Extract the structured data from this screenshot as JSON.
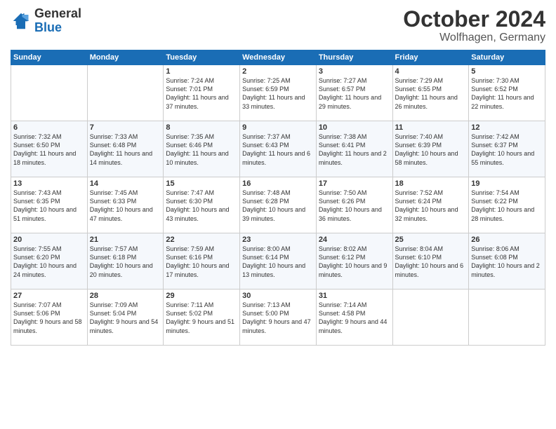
{
  "header": {
    "logo_general": "General",
    "logo_blue": "Blue",
    "month": "October 2024",
    "location": "Wolfhagen, Germany"
  },
  "weekdays": [
    "Sunday",
    "Monday",
    "Tuesday",
    "Wednesday",
    "Thursday",
    "Friday",
    "Saturday"
  ],
  "weeks": [
    [
      {
        "day": "",
        "sunrise": "",
        "sunset": "",
        "daylight": ""
      },
      {
        "day": "",
        "sunrise": "",
        "sunset": "",
        "daylight": ""
      },
      {
        "day": "1",
        "sunrise": "Sunrise: 7:24 AM",
        "sunset": "Sunset: 7:01 PM",
        "daylight": "Daylight: 11 hours and 37 minutes."
      },
      {
        "day": "2",
        "sunrise": "Sunrise: 7:25 AM",
        "sunset": "Sunset: 6:59 PM",
        "daylight": "Daylight: 11 hours and 33 minutes."
      },
      {
        "day": "3",
        "sunrise": "Sunrise: 7:27 AM",
        "sunset": "Sunset: 6:57 PM",
        "daylight": "Daylight: 11 hours and 29 minutes."
      },
      {
        "day": "4",
        "sunrise": "Sunrise: 7:29 AM",
        "sunset": "Sunset: 6:55 PM",
        "daylight": "Daylight: 11 hours and 26 minutes."
      },
      {
        "day": "5",
        "sunrise": "Sunrise: 7:30 AM",
        "sunset": "Sunset: 6:52 PM",
        "daylight": "Daylight: 11 hours and 22 minutes."
      }
    ],
    [
      {
        "day": "6",
        "sunrise": "Sunrise: 7:32 AM",
        "sunset": "Sunset: 6:50 PM",
        "daylight": "Daylight: 11 hours and 18 minutes."
      },
      {
        "day": "7",
        "sunrise": "Sunrise: 7:33 AM",
        "sunset": "Sunset: 6:48 PM",
        "daylight": "Daylight: 11 hours and 14 minutes."
      },
      {
        "day": "8",
        "sunrise": "Sunrise: 7:35 AM",
        "sunset": "Sunset: 6:46 PM",
        "daylight": "Daylight: 11 hours and 10 minutes."
      },
      {
        "day": "9",
        "sunrise": "Sunrise: 7:37 AM",
        "sunset": "Sunset: 6:43 PM",
        "daylight": "Daylight: 11 hours and 6 minutes."
      },
      {
        "day": "10",
        "sunrise": "Sunrise: 7:38 AM",
        "sunset": "Sunset: 6:41 PM",
        "daylight": "Daylight: 11 hours and 2 minutes."
      },
      {
        "day": "11",
        "sunrise": "Sunrise: 7:40 AM",
        "sunset": "Sunset: 6:39 PM",
        "daylight": "Daylight: 10 hours and 58 minutes."
      },
      {
        "day": "12",
        "sunrise": "Sunrise: 7:42 AM",
        "sunset": "Sunset: 6:37 PM",
        "daylight": "Daylight: 10 hours and 55 minutes."
      }
    ],
    [
      {
        "day": "13",
        "sunrise": "Sunrise: 7:43 AM",
        "sunset": "Sunset: 6:35 PM",
        "daylight": "Daylight: 10 hours and 51 minutes."
      },
      {
        "day": "14",
        "sunrise": "Sunrise: 7:45 AM",
        "sunset": "Sunset: 6:33 PM",
        "daylight": "Daylight: 10 hours and 47 minutes."
      },
      {
        "day": "15",
        "sunrise": "Sunrise: 7:47 AM",
        "sunset": "Sunset: 6:30 PM",
        "daylight": "Daylight: 10 hours and 43 minutes."
      },
      {
        "day": "16",
        "sunrise": "Sunrise: 7:48 AM",
        "sunset": "Sunset: 6:28 PM",
        "daylight": "Daylight: 10 hours and 39 minutes."
      },
      {
        "day": "17",
        "sunrise": "Sunrise: 7:50 AM",
        "sunset": "Sunset: 6:26 PM",
        "daylight": "Daylight: 10 hours and 36 minutes."
      },
      {
        "day": "18",
        "sunrise": "Sunrise: 7:52 AM",
        "sunset": "Sunset: 6:24 PM",
        "daylight": "Daylight: 10 hours and 32 minutes."
      },
      {
        "day": "19",
        "sunrise": "Sunrise: 7:54 AM",
        "sunset": "Sunset: 6:22 PM",
        "daylight": "Daylight: 10 hours and 28 minutes."
      }
    ],
    [
      {
        "day": "20",
        "sunrise": "Sunrise: 7:55 AM",
        "sunset": "Sunset: 6:20 PM",
        "daylight": "Daylight: 10 hours and 24 minutes."
      },
      {
        "day": "21",
        "sunrise": "Sunrise: 7:57 AM",
        "sunset": "Sunset: 6:18 PM",
        "daylight": "Daylight: 10 hours and 20 minutes."
      },
      {
        "day": "22",
        "sunrise": "Sunrise: 7:59 AM",
        "sunset": "Sunset: 6:16 PM",
        "daylight": "Daylight: 10 hours and 17 minutes."
      },
      {
        "day": "23",
        "sunrise": "Sunrise: 8:00 AM",
        "sunset": "Sunset: 6:14 PM",
        "daylight": "Daylight: 10 hours and 13 minutes."
      },
      {
        "day": "24",
        "sunrise": "Sunrise: 8:02 AM",
        "sunset": "Sunset: 6:12 PM",
        "daylight": "Daylight: 10 hours and 9 minutes."
      },
      {
        "day": "25",
        "sunrise": "Sunrise: 8:04 AM",
        "sunset": "Sunset: 6:10 PM",
        "daylight": "Daylight: 10 hours and 6 minutes."
      },
      {
        "day": "26",
        "sunrise": "Sunrise: 8:06 AM",
        "sunset": "Sunset: 6:08 PM",
        "daylight": "Daylight: 10 hours and 2 minutes."
      }
    ],
    [
      {
        "day": "27",
        "sunrise": "Sunrise: 7:07 AM",
        "sunset": "Sunset: 5:06 PM",
        "daylight": "Daylight: 9 hours and 58 minutes."
      },
      {
        "day": "28",
        "sunrise": "Sunrise: 7:09 AM",
        "sunset": "Sunset: 5:04 PM",
        "daylight": "Daylight: 9 hours and 54 minutes."
      },
      {
        "day": "29",
        "sunrise": "Sunrise: 7:11 AM",
        "sunset": "Sunset: 5:02 PM",
        "daylight": "Daylight: 9 hours and 51 minutes."
      },
      {
        "day": "30",
        "sunrise": "Sunrise: 7:13 AM",
        "sunset": "Sunset: 5:00 PM",
        "daylight": "Daylight: 9 hours and 47 minutes."
      },
      {
        "day": "31",
        "sunrise": "Sunrise: 7:14 AM",
        "sunset": "Sunset: 4:58 PM",
        "daylight": "Daylight: 9 hours and 44 minutes."
      },
      {
        "day": "",
        "sunrise": "",
        "sunset": "",
        "daylight": ""
      },
      {
        "day": "",
        "sunrise": "",
        "sunset": "",
        "daylight": ""
      }
    ]
  ]
}
